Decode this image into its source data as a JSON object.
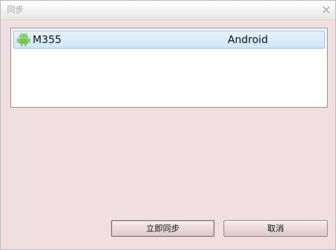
{
  "window": {
    "title": "同步"
  },
  "devices": [
    {
      "name": "M355",
      "os": "Android",
      "icon": "android-icon"
    }
  ],
  "buttons": {
    "sync_now": "立即同步",
    "cancel": "取消"
  },
  "colors": {
    "dialog_bg": "#efdfe2",
    "selection_bg": "#d2e6f7",
    "android_green": "#78c257"
  }
}
